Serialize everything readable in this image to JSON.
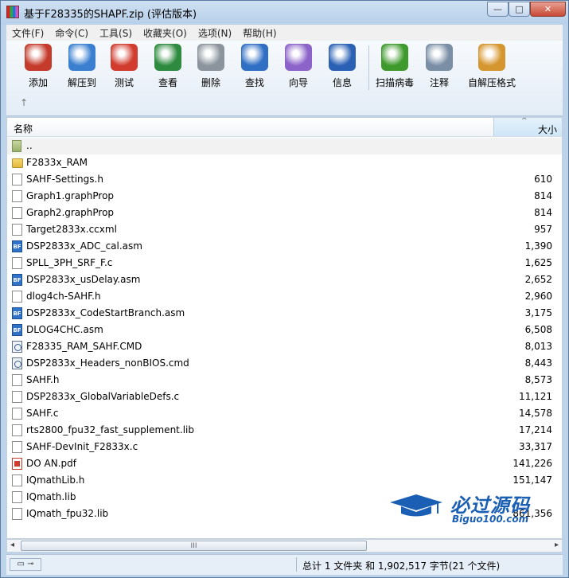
{
  "window": {
    "title": "基于F28335的SHAPF.zip (评估版本)",
    "min_symbol": "—",
    "max_symbol": "□",
    "close_symbol": "✕"
  },
  "menu": [
    "文件(F)",
    "命令(C)",
    "工具(S)",
    "收藏夹(O)",
    "选项(N)",
    "帮助(H)"
  ],
  "toolbar": [
    {
      "label": "添加",
      "icon": "add-archive-icon",
      "color": "#c43b2b"
    },
    {
      "label": "解压到",
      "icon": "extract-folder-icon",
      "color": "#3a7fd0"
    },
    {
      "label": "测试",
      "icon": "test-clipboard-icon",
      "color": "#d13c2e"
    },
    {
      "label": "查看",
      "icon": "view-book-icon",
      "color": "#2d8a3e"
    },
    {
      "label": "删除",
      "icon": "delete-trash-icon",
      "color": "#8b949c"
    },
    {
      "label": "查找",
      "icon": "find-magnifier-icon",
      "color": "#2f6fc4"
    },
    {
      "label": "向导",
      "icon": "wizard-wand-icon",
      "color": "#8b63c9"
    },
    {
      "label": "信息",
      "icon": "info-icon",
      "color": "#2b61b5"
    },
    {
      "label": "扫描病毒",
      "icon": "virus-scan-icon",
      "color": "#3e9a2c"
    },
    {
      "label": "注释",
      "icon": "comment-icon",
      "color": "#7a8fa6"
    },
    {
      "label": "自解压格式",
      "icon": "sfx-box-icon",
      "color": "#d6962f"
    }
  ],
  "up_arrow": "↑",
  "columns": {
    "name": "名称",
    "size": "大小",
    "sort_arrow": "^"
  },
  "files": [
    {
      "name": "..",
      "size": "",
      "type": "up"
    },
    {
      "name": "F2833x_RAM",
      "size": "",
      "type": "folder"
    },
    {
      "name": "SAHF-Settings.h",
      "size": "610",
      "type": "doc"
    },
    {
      "name": "Graph1.graphProp",
      "size": "814",
      "type": "doc"
    },
    {
      "name": "Graph2.graphProp",
      "size": "814",
      "type": "doc"
    },
    {
      "name": "Target2833x.ccxml",
      "size": "957",
      "type": "doc"
    },
    {
      "name": "DSP2833x_ADC_cal.asm",
      "size": "1,390",
      "type": "asm"
    },
    {
      "name": "SPLL_3PH_SRF_F.c",
      "size": "1,625",
      "type": "doc"
    },
    {
      "name": "DSP2833x_usDelay.asm",
      "size": "2,652",
      "type": "asm"
    },
    {
      "name": "dlog4ch-SAHF.h",
      "size": "2,960",
      "type": "doc"
    },
    {
      "name": "DSP2833x_CodeStartBranch.asm",
      "size": "3,175",
      "type": "asm"
    },
    {
      "name": "DLOG4CHC.asm",
      "size": "6,508",
      "type": "asm"
    },
    {
      "name": "F28335_RAM_SAHF.CMD",
      "size": "8,013",
      "type": "cmd"
    },
    {
      "name": "DSP2833x_Headers_nonBIOS.cmd",
      "size": "8,443",
      "type": "cmd"
    },
    {
      "name": "SAHF.h",
      "size": "8,573",
      "type": "doc"
    },
    {
      "name": "DSP2833x_GlobalVariableDefs.c",
      "size": "11,121",
      "type": "doc"
    },
    {
      "name": "SAHF.c",
      "size": "14,578",
      "type": "doc"
    },
    {
      "name": "rts2800_fpu32_fast_supplement.lib",
      "size": "17,214",
      "type": "doc"
    },
    {
      "name": "SAHF-DevInit_F2833x.c",
      "size": "33,317",
      "type": "doc"
    },
    {
      "name": "DO AN.pdf",
      "size": "141,226",
      "type": "pdf"
    },
    {
      "name": "IQmathLib.h",
      "size": "151,147",
      "type": "doc"
    },
    {
      "name": "IQmath.lib",
      "size": "",
      "type": "doc"
    },
    {
      "name": "IQmath_fpu32.lib",
      "size": "861,356",
      "type": "doc"
    }
  ],
  "scroll": {
    "left": "◂",
    "right": "▸",
    "grip": "III"
  },
  "status": {
    "text": "总计 1 文件夹 和 1,902,517 字节(21 个文件)"
  },
  "watermark": {
    "title": "必过源码",
    "url": "Biguo100.com"
  }
}
